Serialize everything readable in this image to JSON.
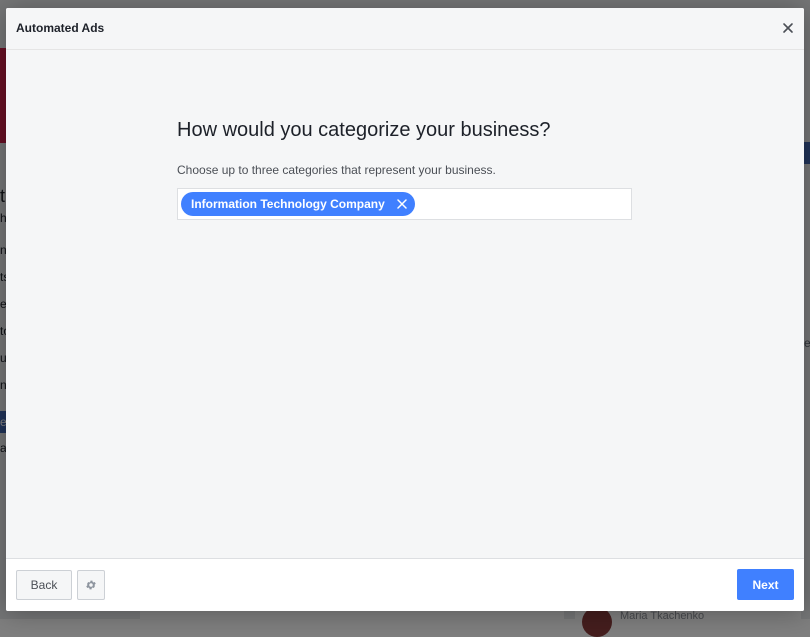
{
  "modal": {
    "title": "Automated Ads",
    "close_icon": "close-icon",
    "question": "How would you categorize your business?",
    "helper_text": "Choose up to three categories that represent your business.",
    "selected_categories": [
      {
        "label": "Information Technology Company",
        "remove_icon": "close-icon"
      }
    ],
    "footer": {
      "back_label": "Back",
      "settings_icon": "gear-icon",
      "next_label": "Next"
    },
    "colors": {
      "accent": "#4080ff",
      "background": "#f5f6f7"
    }
  },
  "background": {
    "left_fragments": [
      "t",
      "h",
      "n",
      "ts",
      "ec",
      "to",
      "u",
      "n",
      "e",
      "a"
    ],
    "right_fragment": "e",
    "bottom_name": "Maria Tkachenko"
  }
}
